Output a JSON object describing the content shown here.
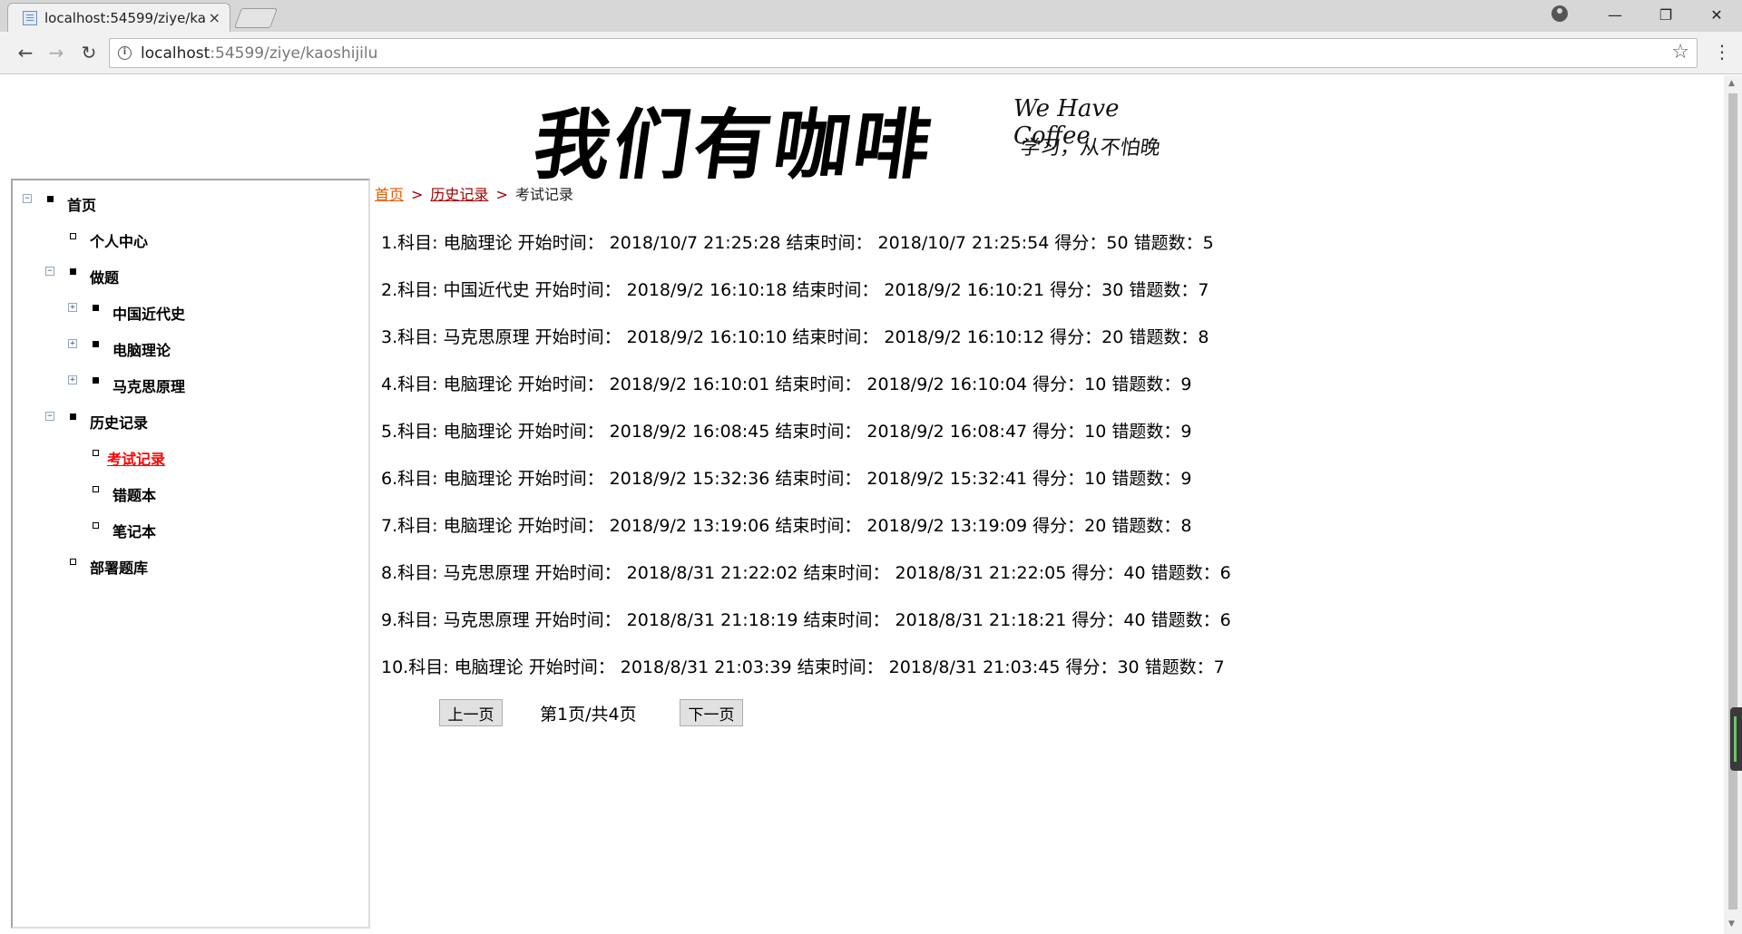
{
  "browser": {
    "tab_title": "localhost:54599/ziye/ka",
    "tab_close": "×",
    "url_host": "localhost",
    "url_rest": ":54599/ziye/kaoshijilu",
    "back": "←",
    "forward": "→",
    "reload": "↻",
    "star": "☆",
    "menu": "⋮",
    "minimize": "—",
    "restore": "❐",
    "close": "✕"
  },
  "logo": {
    "main": "我们有咖啡",
    "english": "We Have Coffee",
    "slogan": "学习，从不怕晚"
  },
  "sidebar": {
    "items": [
      {
        "label": "首页",
        "expander": "−"
      },
      {
        "label": "个人中心"
      },
      {
        "label": "做题",
        "expander": "−"
      },
      {
        "label": "中国近代史",
        "expander": "+"
      },
      {
        "label": "电脑理论",
        "expander": "+"
      },
      {
        "label": "马克思原理",
        "expander": "+"
      },
      {
        "label": "历史记录",
        "expander": "−"
      },
      {
        "label": "考试记录"
      },
      {
        "label": "错题本"
      },
      {
        "label": "笔记本"
      },
      {
        "label": "部署题库"
      }
    ]
  },
  "breadcrumb": {
    "home": "首页",
    "history": "历史记录",
    "current": "考试记录",
    "sep": ">"
  },
  "records": [
    "1.科目: 电脑理论 开始时间： 2018/10/7 21:25:28 结束时间： 2018/10/7 21:25:54 得分：50 错题数：5",
    "2.科目: 中国近代史 开始时间： 2018/9/2 16:10:18 结束时间： 2018/9/2 16:10:21 得分：30 错题数：7",
    "3.科目: 马克思原理 开始时间： 2018/9/2 16:10:10 结束时间： 2018/9/2 16:10:12 得分：20 错题数：8",
    "4.科目: 电脑理论 开始时间： 2018/9/2 16:10:01 结束时间： 2018/9/2 16:10:04 得分：10 错题数：9",
    "5.科目: 电脑理论 开始时间： 2018/9/2 16:08:45 结束时间： 2018/9/2 16:08:47 得分：10 错题数：9",
    "6.科目: 电脑理论 开始时间： 2018/9/2 15:32:36 结束时间： 2018/9/2 15:32:41 得分：10 错题数：9",
    "7.科目: 电脑理论 开始时间： 2018/9/2 13:19:06 结束时间： 2018/9/2 13:19:09 得分：20 错题数：8",
    "8.科目: 马克思原理 开始时间： 2018/8/31 21:22:02 结束时间： 2018/8/31 21:22:05 得分：40 错题数：6",
    "9.科目: 马克思原理 开始时间： 2018/8/31 21:18:19 结束时间： 2018/8/31 21:18:21 得分：40 错题数：6",
    "10.科目: 电脑理论 开始时间： 2018/8/31 21:03:39 结束时间： 2018/8/31 21:03:45 得分：30 错题数：7"
  ],
  "pager": {
    "prev": "上一页",
    "info": "第1页/共4页",
    "next": "下一页"
  }
}
